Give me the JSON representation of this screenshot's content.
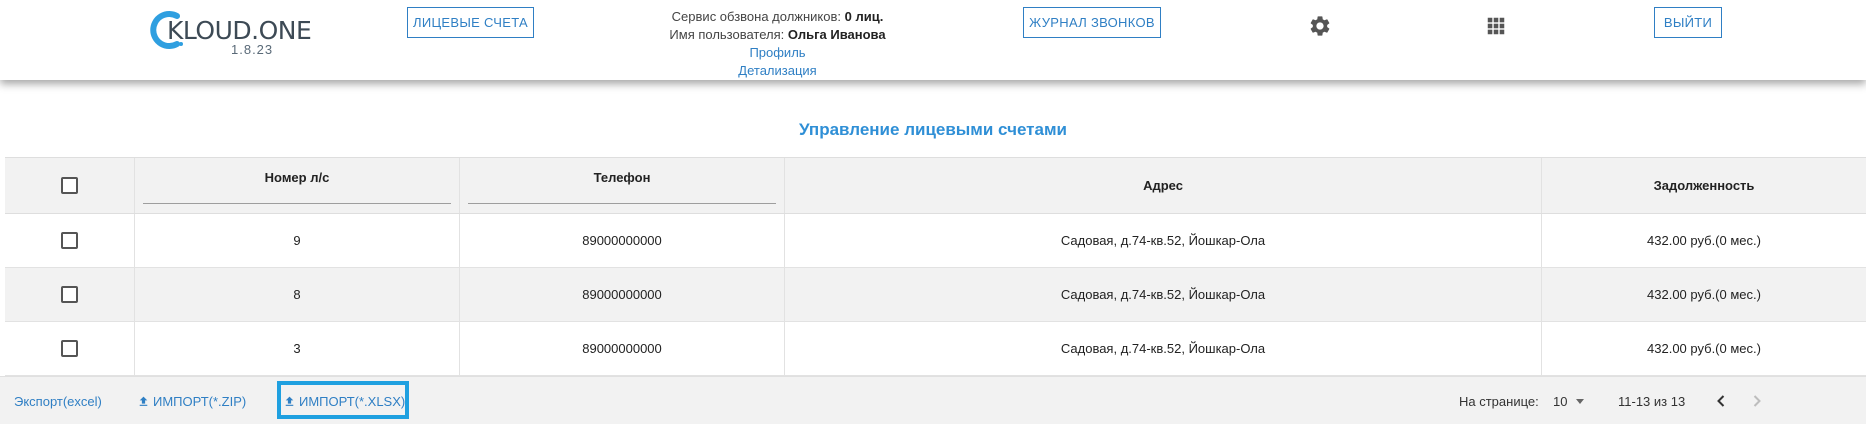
{
  "header": {
    "logo": {
      "name": "KLOUD.ONE",
      "version": "1.8.23"
    },
    "accounts_button": "ЛИЦЕВЫЕ СЧЕТА",
    "service": {
      "label": "Сервис обзвона должников:",
      "value": "0 лиц.",
      "user_label": "Имя пользователя:",
      "user_name": "Ольга Иванова",
      "profile_link": "Профиль",
      "details_link": "Детализация"
    },
    "calls_log_button": "ЖУРНАЛ ЗВОНКОВ",
    "settings_icon": "gear-icon",
    "apps_icon": "apps-grid-icon",
    "logout_button": "ВЫЙТИ"
  },
  "page_title": "Управление лицевыми счетами",
  "table": {
    "columns": [
      "Номер л/с",
      "Телефон",
      "Адрес",
      "Задолженность"
    ],
    "rows": [
      {
        "account": "9",
        "phone": "89000000000",
        "address": "Садовая, д.74-кв.52, Йошкар-Ола",
        "debt": "432.00 руб.(0 мес.)"
      },
      {
        "account": "8",
        "phone": "89000000000",
        "address": "Садовая, д.74-кв.52, Йошкар-Ола",
        "debt": "432.00 руб.(0 мес.)"
      },
      {
        "account": "3",
        "phone": "89000000000",
        "address": "Садовая, д.74-кв.52, Йошкар-Ола",
        "debt": "432.00 руб.(0 мес.)"
      }
    ]
  },
  "footer": {
    "export_link": "Экспорт(excel)",
    "import_zip": "ИМПОРТ(*.ZIP)",
    "import_xlsx": "ИМПОРТ(*.XLSX)",
    "upload_icon": "upload-icon",
    "per_page_label": "На странице:",
    "per_page_value": "10",
    "range": "11-13 из 13",
    "prev_icon": "chevron-left-icon",
    "next_icon": "chevron-right-icon"
  },
  "colors": {
    "accent": "#2f7fc4",
    "title": "#2f8fd6",
    "highlight": "#1fa0e0",
    "row_alt": "#f2f2f2"
  }
}
